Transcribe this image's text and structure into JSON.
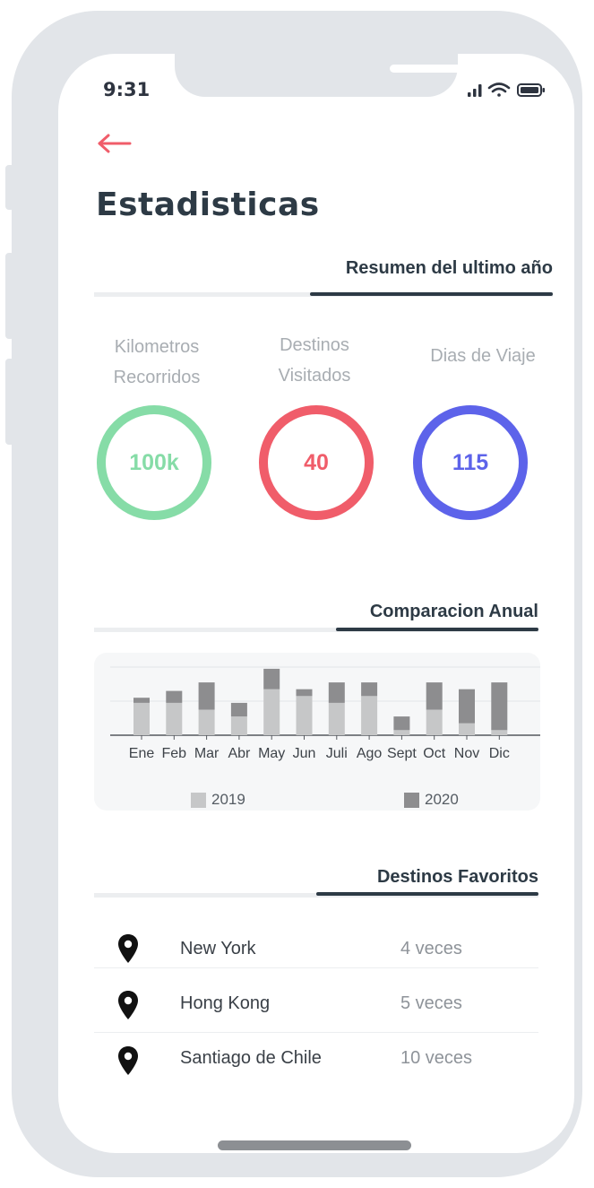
{
  "status_bar": {
    "time": "9:31",
    "icons": [
      "signal-icon",
      "wifi-icon",
      "battery-icon"
    ]
  },
  "header": {
    "back_icon": "arrow-left-icon",
    "title": "Estadisticas"
  },
  "summary": {
    "heading": "Resumen del ultimo año",
    "stats": [
      {
        "label_line1": "Kilometros",
        "label_line2": "Recorridos",
        "value": "100k",
        "color": "#86dca7"
      },
      {
        "label_line1": "Destinos",
        "label_line2": "Visitados",
        "value": "40",
        "color": "#f05d6a"
      },
      {
        "label_line1": "Dias de Viaje",
        "label_line2": "",
        "value": "115",
        "color": "#5d63ea"
      }
    ]
  },
  "comparison": {
    "heading": "Comparacion Anual"
  },
  "chart_data": {
    "type": "bar",
    "stacked": true,
    "categories": [
      "Ene",
      "Feb",
      "Mar",
      "Abr",
      "May",
      "Jun",
      "Juli",
      "Ago",
      "Sept",
      "Oct",
      "Nov",
      "Dic"
    ],
    "series": [
      {
        "name": "2019",
        "color": "#c6c7c8",
        "values": [
          9.5,
          9.5,
          7.5,
          5.5,
          13.5,
          11.5,
          9.5,
          11.5,
          1.5,
          7.5,
          3.5,
          1.5
        ]
      },
      {
        "name": "2020",
        "color": "#8d8d8f",
        "values": [
          1.5,
          3.5,
          8,
          4,
          6,
          2,
          6,
          4,
          4,
          8,
          10,
          14
        ]
      }
    ],
    "grid": true,
    "legend": "bottom"
  },
  "favorites": {
    "heading": "Destinos Favoritos",
    "items": [
      {
        "name": "New York",
        "count": "4 veces",
        "icon": "location-pin-icon"
      },
      {
        "name": "Hong Kong",
        "count": "5 veces",
        "icon": "location-pin-icon"
      },
      {
        "name": "Santiago de Chile",
        "count": "10 veces",
        "icon": "location-pin-icon"
      }
    ]
  },
  "colors": {
    "accent": "#f05d6a",
    "text_dark": "#2d3a45",
    "frame": "#e2e5e9"
  }
}
